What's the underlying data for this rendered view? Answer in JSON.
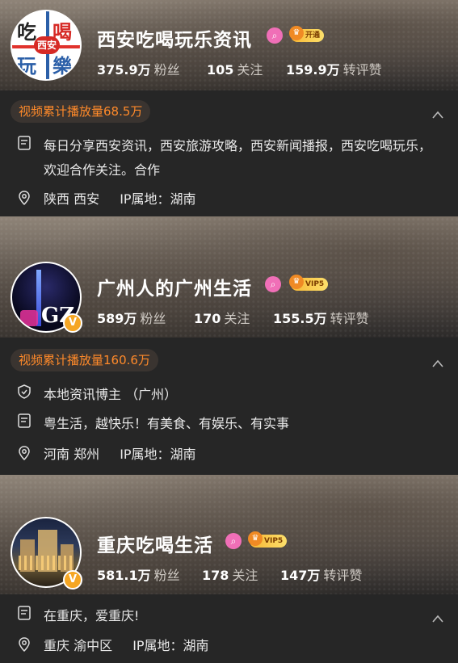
{
  "accounts": [
    {
      "name": "西安吃喝玩乐资讯",
      "badge_text": "开通",
      "avatar_text": "西安",
      "avatar_chars": [
        "吃",
        "喝",
        "玩",
        "樂"
      ],
      "stats": [
        {
          "value": "375.9万",
          "label": "粉丝"
        },
        {
          "value": "105",
          "label": "关注"
        },
        {
          "value": "159.9万",
          "label": "转评赞"
        }
      ],
      "views": "视频累计播放量68.5万",
      "bio": "每日分享西安资讯，西安旅游攻略，西安新闻播报，西安吃喝玩乐，欢迎合作关注。合作",
      "location": "陕西 西安",
      "ip": "IP属地：湖南"
    },
    {
      "name": "广州人的广州生活",
      "badge_text": "VIP5",
      "avatar_text": "GZ",
      "stats": [
        {
          "value": "589万",
          "label": "粉丝"
        },
        {
          "value": "170",
          "label": "关注"
        },
        {
          "value": "155.5万",
          "label": "转评赞"
        }
      ],
      "views": "视频累计播放量160.6万",
      "certification": "本地资讯博主 （广州）",
      "bio": "粤生活，越快乐！有美食、有娱乐、有实事",
      "location": "河南 郑州",
      "ip": "IP属地：湖南"
    },
    {
      "name": "重庆吃喝生活",
      "badge_text": "VIP5",
      "stats": [
        {
          "value": "581.1万",
          "label": "粉丝"
        },
        {
          "value": "178",
          "label": "关注"
        },
        {
          "value": "147万",
          "label": "转评赞"
        }
      ],
      "bio": "在重庆，爱重庆!",
      "location": "重庆 渝中区",
      "ip": "IP属地：湖南"
    }
  ],
  "icons": {
    "verified": "v-verified-icon",
    "search_badge": "magnifier-icon",
    "crown": "crown-icon",
    "document": "document-icon",
    "location": "location-pin-icon",
    "shield": "shield-check-icon",
    "collapse": "chevron-up-icon"
  },
  "colors": {
    "views_accent": "#ff8a2a",
    "pink_badge": "#f06fb7",
    "vip_gold": "#f7b733",
    "verified_gold": "#f5a623"
  }
}
